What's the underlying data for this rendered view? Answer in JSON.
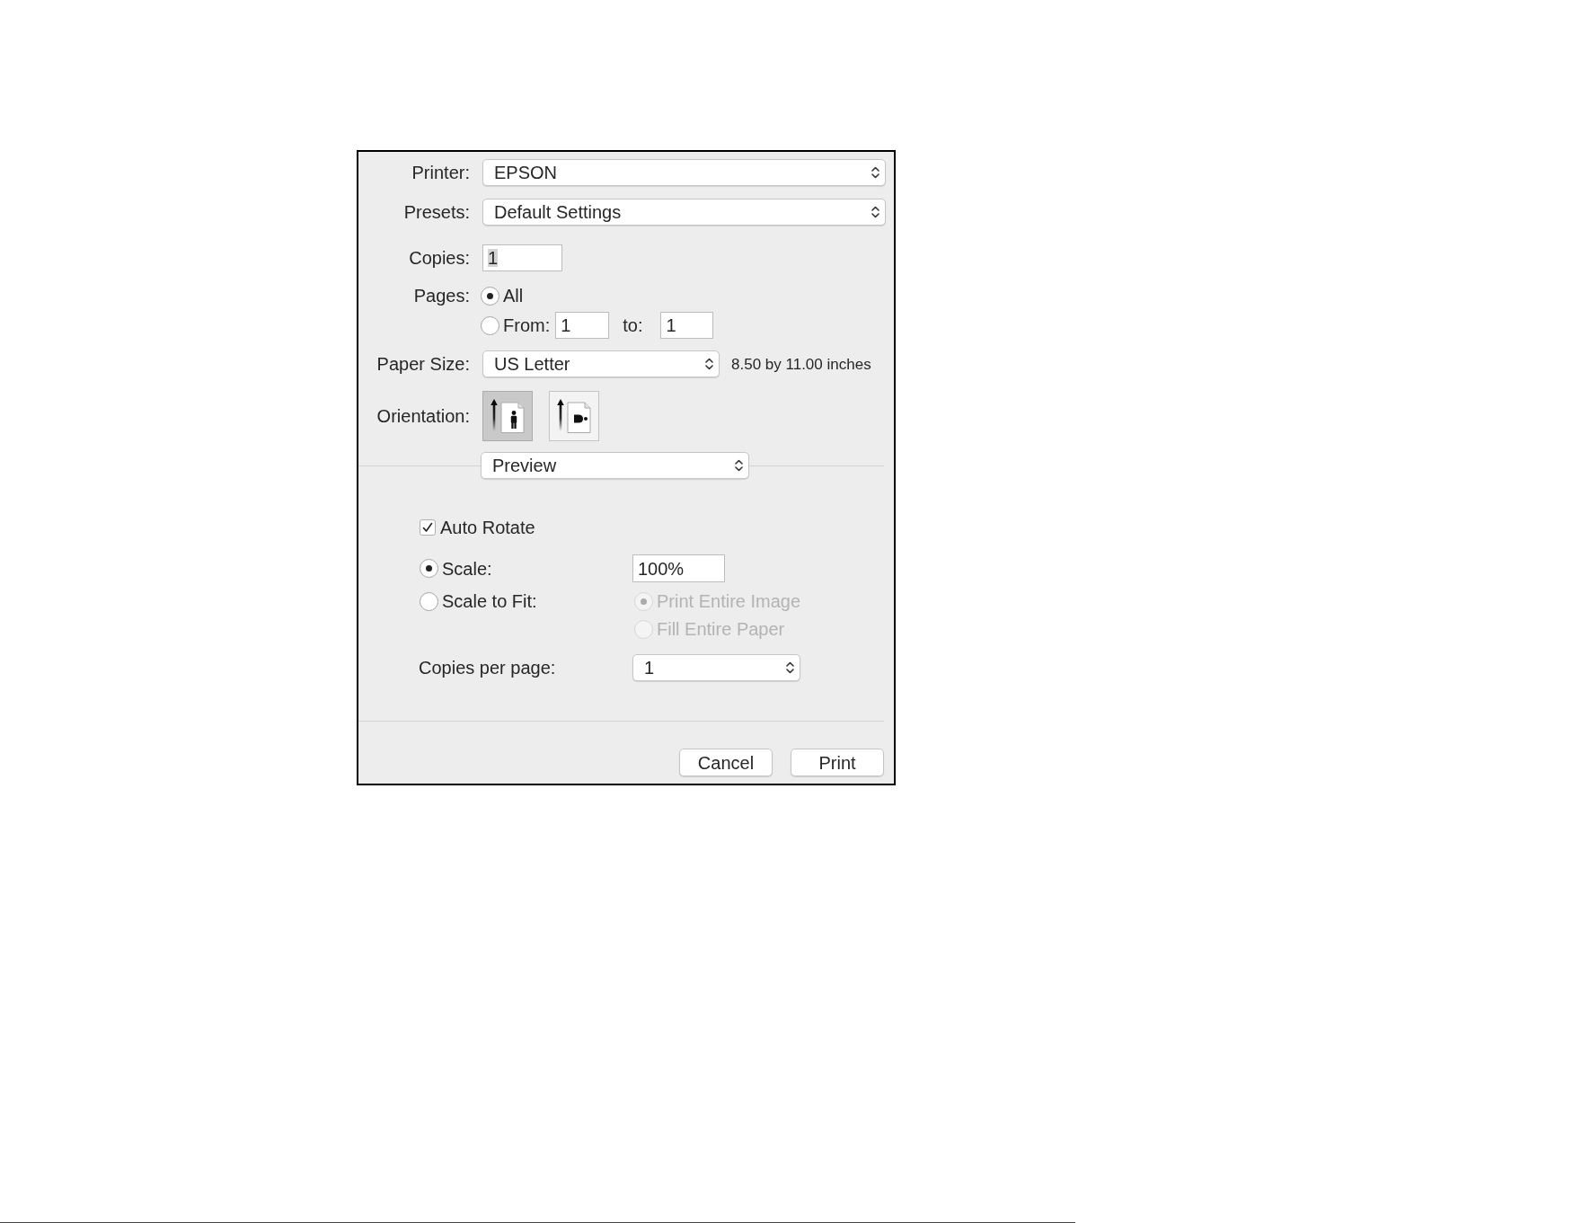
{
  "dialog": {
    "printer": {
      "label": "Printer:",
      "value": "EPSON"
    },
    "presets": {
      "label": "Presets:",
      "value": "Default Settings"
    },
    "copies": {
      "label": "Copies:",
      "value": "1",
      "text_selected": true
    },
    "pages": {
      "label": "Pages:",
      "options": [
        {
          "kind": "all",
          "label": "All",
          "selected": true
        },
        {
          "kind": "range",
          "label": "From:",
          "selected": false,
          "from": "1",
          "to_label": "to:",
          "to": "1"
        }
      ]
    },
    "paper_size": {
      "label": "Paper Size:",
      "value": "US Letter",
      "dimensions": "8.50 by 11.00 inches"
    },
    "orientation": {
      "label": "Orientation:",
      "options": [
        {
          "kind": "portrait",
          "selected": true
        },
        {
          "kind": "landscape",
          "selected": false
        }
      ]
    },
    "section_menu": {
      "value": "Preview"
    },
    "auto_rotate": {
      "label": "Auto Rotate",
      "checked": true
    },
    "scaling": [
      {
        "kind": "scale",
        "label": "Scale:",
        "selected": true,
        "value": "100%"
      },
      {
        "kind": "fit",
        "label": "Scale to Fit:",
        "selected": false,
        "options": [
          {
            "label": "Print Entire Image",
            "selected": true,
            "disabled": true
          },
          {
            "label": "Fill Entire Paper",
            "selected": false,
            "disabled": true
          }
        ]
      }
    ],
    "copies_per_page": {
      "label": "Copies per page:",
      "value": "1"
    },
    "buttons": [
      "Cancel",
      "Print"
    ]
  }
}
